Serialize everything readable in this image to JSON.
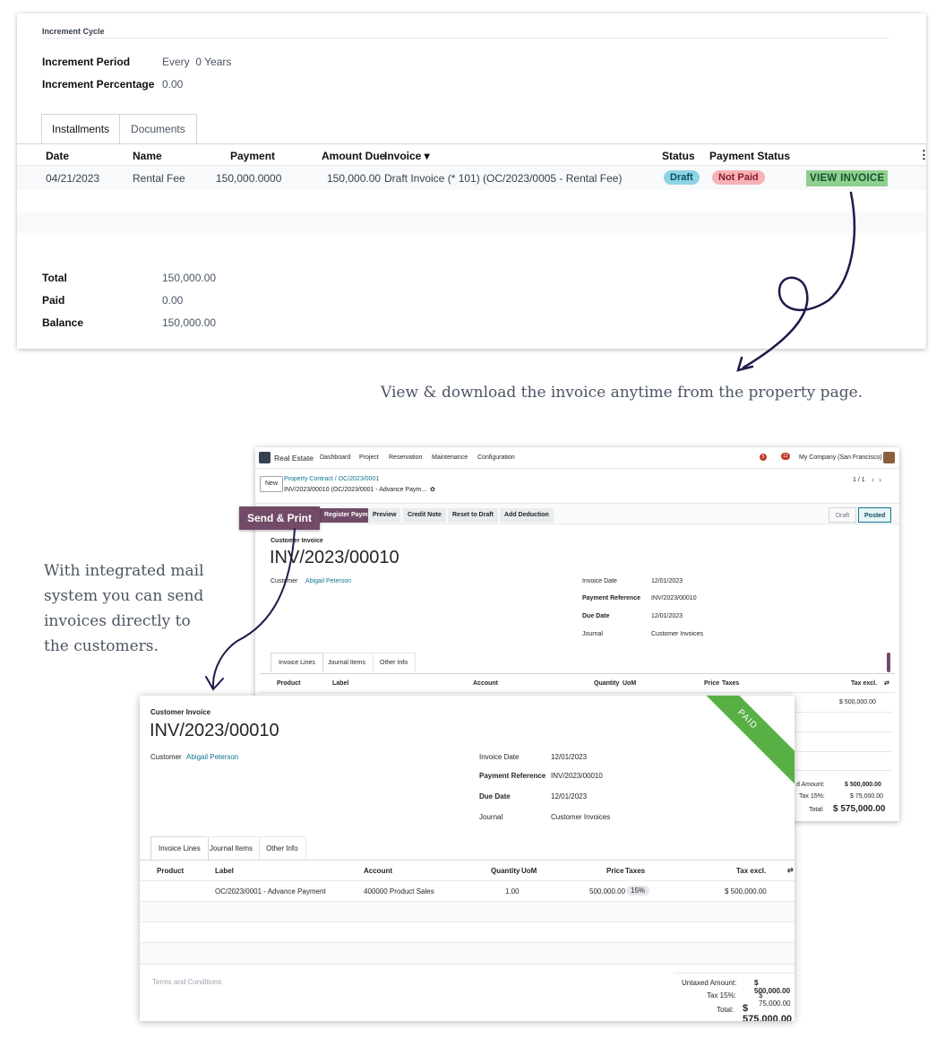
{
  "top_card": {
    "section_title": "Increment Cycle",
    "fields": [
      {
        "label": "Increment Period",
        "value": "Every  0 Years"
      },
      {
        "label": "Increment Percentage",
        "value": "0.00"
      }
    ],
    "tabs": [
      "Installments",
      "Documents"
    ],
    "columns": [
      "Date",
      "Name",
      "Payment",
      "Amount Due",
      "Invoice ▾",
      "Status",
      "Payment Status"
    ],
    "row": {
      "date": "04/21/2023",
      "name": "Rental Fee",
      "payment": "150,000.0000",
      "amount_due": "150,000.00",
      "invoice": "Draft Invoice (* 101) (OC/2023/0005 - Rental Fee)",
      "status": "Draft",
      "payment_status": "Not Paid",
      "action": "VIEW INVOICE"
    },
    "totals": [
      {
        "label": "Total",
        "value": "150,000.00"
      },
      {
        "label": "Paid",
        "value": "0.00"
      },
      {
        "label": "Balance",
        "value": "150,000.00"
      }
    ]
  },
  "captions": {
    "view": "View & download the invoice anytime from the property page.",
    "mail": [
      "With integrated mail",
      "system you can send",
      "invoices directly to",
      "the customers."
    ]
  },
  "app": {
    "title": "Real Estate",
    "menu": [
      "Dashboard",
      "Project",
      "Reservation",
      "Maintenance",
      "Configuration"
    ],
    "badge1": "5",
    "badge2": "12",
    "company": "My Company (San Francisco)",
    "new_btn": "New",
    "breadcrumb": "Property Contract / OC/2023/0001",
    "record": "INV/2023/00010 (OC/2023/0001 - Advance Paym...",
    "pager": "1 / 1",
    "buttons": [
      "Register Payment",
      "Preview",
      "Credit Note",
      "Reset to Draft",
      "Add Deduction"
    ],
    "send_print": "Send & Print",
    "states": [
      "Draft",
      "Posted"
    ]
  },
  "invoice": {
    "type": "Customer Invoice",
    "number": "INV/2023/00010",
    "customer_label": "Customer",
    "customer": "Abigail Peterson",
    "fields": [
      {
        "label": "Invoice Date",
        "value": "12/01/2023"
      },
      {
        "label": "Payment Reference",
        "value": "INV/2023/00010"
      },
      {
        "label": "Due Date",
        "value": "12/01/2023"
      },
      {
        "label": "Journal",
        "value": "Customer Invoices"
      }
    ],
    "tabs": [
      "Invoice Lines",
      "Journal Items",
      "Other Info"
    ],
    "columns": [
      "Product",
      "Label",
      "Account",
      "Quantity",
      "UoM",
      "Price",
      "Taxes",
      "Tax excl."
    ],
    "line": {
      "label": "OC/2023/0001 - Advance Payment",
      "account": "400000 Product Sales",
      "qty": "1.00",
      "price": "500,000.00",
      "tax": "15%",
      "excl": "$ 500,000.00"
    },
    "terms": "Terms and Conditions",
    "ribbon": "PAID",
    "totals": [
      {
        "label": "Untaxed Amount:",
        "value": "$ 500,000.00"
      },
      {
        "label": "Tax 15%:",
        "value": "$ 75,000.00"
      },
      {
        "label": "Total:",
        "value": "$ 575,000.00"
      }
    ],
    "back_totals": [
      {
        "label": "d Amount:",
        "value": "$ 500,000.00"
      },
      {
        "label": "Tax 15%:",
        "value": "$ 75,000.00"
      },
      {
        "label": "Total:",
        "value": "$ 575,000.00"
      }
    ]
  }
}
